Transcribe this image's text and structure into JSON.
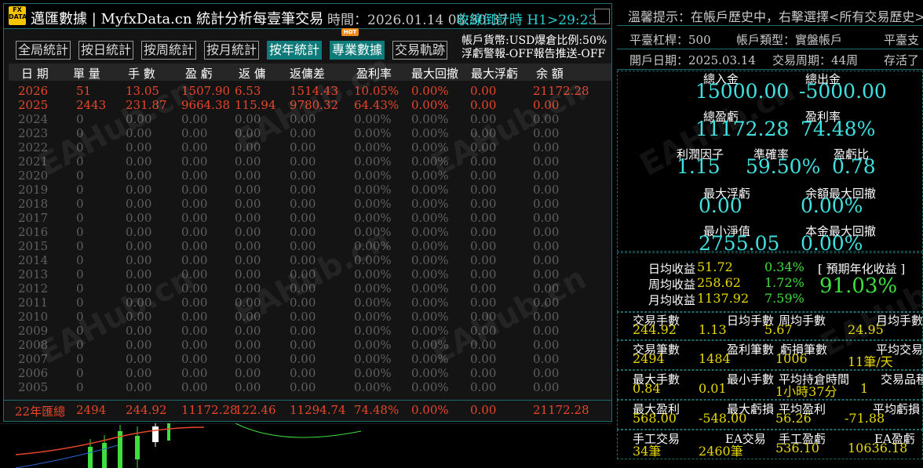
{
  "window": {
    "logo_top": "FX",
    "logo_bottom": "DATA",
    "title": "邁匯數據 | MyfxData.cn  統計分析每壹筆交易",
    "time": "時間：2026.01.14 08:30:37",
    "countdown": "收線倒計時  H1>29:23"
  },
  "tabs": [
    {
      "label": "全局統計"
    },
    {
      "label": "按日統計"
    },
    {
      "label": "按周統計"
    },
    {
      "label": "按月統計"
    },
    {
      "label": "按年統計"
    },
    {
      "label": "專業數據"
    },
    {
      "label": "交易軌跡"
    }
  ],
  "hot_badge": "HOT",
  "account_info": {
    "line1": "帳戶貨幣:USD",
    "line1b": "爆倉比例:50%",
    "line2": "浮虧警報-OFF",
    "line2b": "報告推送-OFF"
  },
  "table": {
    "headers": [
      "日 期",
      "單 量",
      "手 數",
      "盈 虧",
      "返 傭",
      "返傭差",
      "盈利率",
      "最大回撤",
      "最大浮虧",
      "余 額"
    ],
    "rows": [
      [
        "2026",
        "51",
        "13.05",
        "1507.90",
        "6.53",
        "1514.43",
        "10.05%",
        "0.00%",
        "0.00",
        "21172.28"
      ],
      [
        "2025",
        "2443",
        "231.87",
        "9664.38",
        "115.94",
        "9780.32",
        "64.43%",
        "0.00%",
        "0.00",
        "0.00"
      ],
      [
        "2024",
        "0",
        "0.00",
        "0.00",
        "0.00",
        "0.00",
        "0.00%",
        "0.00%",
        "0.00",
        "0.00"
      ],
      [
        "2023",
        "0",
        "0.00",
        "0.00",
        "0.00",
        "0.00",
        "0.00%",
        "0.00%",
        "0.00",
        "0.00"
      ],
      [
        "2022",
        "0",
        "0.00",
        "0.00",
        "0.00",
        "0.00",
        "0.00%",
        "0.00%",
        "0.00",
        "0.00"
      ],
      [
        "2021",
        "0",
        "0.00",
        "0.00",
        "0.00",
        "0.00",
        "0.00%",
        "0.00%",
        "0.00",
        "0.00"
      ],
      [
        "2020",
        "0",
        "0.00",
        "0.00",
        "0.00",
        "0.00",
        "0.00%",
        "0.00%",
        "0.00",
        "0.00"
      ],
      [
        "2019",
        "0",
        "0.00",
        "0.00",
        "0.00",
        "0.00",
        "0.00%",
        "0.00%",
        "0.00",
        "0.00"
      ],
      [
        "2018",
        "0",
        "0.00",
        "0.00",
        "0.00",
        "0.00",
        "0.00%",
        "0.00%",
        "0.00",
        "0.00"
      ],
      [
        "2017",
        "0",
        "0.00",
        "0.00",
        "0.00",
        "0.00",
        "0.00%",
        "0.00%",
        "0.00",
        "0.00"
      ],
      [
        "2016",
        "0",
        "0.00",
        "0.00",
        "0.00",
        "0.00",
        "0.00%",
        "0.00%",
        "0.00",
        "0.00"
      ],
      [
        "2015",
        "0",
        "0.00",
        "0.00",
        "0.00",
        "0.00",
        "0.00%",
        "0.00%",
        "0.00",
        "0.00"
      ],
      [
        "2014",
        "0",
        "0.00",
        "0.00",
        "0.00",
        "0.00",
        "0.00%",
        "0.00%",
        "0.00",
        "0.00"
      ],
      [
        "2013",
        "0",
        "0.00",
        "0.00",
        "0.00",
        "0.00",
        "0.00%",
        "0.00%",
        "0.00",
        "0.00"
      ],
      [
        "2012",
        "0",
        "0.00",
        "0.00",
        "0.00",
        "0.00",
        "0.00%",
        "0.00%",
        "0.00",
        "0.00"
      ],
      [
        "2011",
        "0",
        "0.00",
        "0.00",
        "0.00",
        "0.00",
        "0.00%",
        "0.00%",
        "0.00",
        "0.00"
      ],
      [
        "2010",
        "0",
        "0.00",
        "0.00",
        "0.00",
        "0.00",
        "0.00%",
        "0.00%",
        "0.00",
        "0.00"
      ],
      [
        "2009",
        "0",
        "0.00",
        "0.00",
        "0.00",
        "0.00",
        "0.00%",
        "0.00%",
        "0.00",
        "0.00"
      ],
      [
        "2008",
        "0",
        "0.00",
        "0.00",
        "0.00",
        "0.00",
        "0.00%",
        "0.00%",
        "0.00",
        "0.00"
      ],
      [
        "2007",
        "0",
        "0.00",
        "0.00",
        "0.00",
        "0.00",
        "0.00%",
        "0.00%",
        "0.00",
        "0.00"
      ],
      [
        "2006",
        "0",
        "0.00",
        "0.00",
        "0.00",
        "0.00",
        "0.00%",
        "0.00%",
        "0.00",
        "0.00"
      ],
      [
        "2005",
        "0",
        "0.00",
        "0.00",
        "0.00",
        "0.00",
        "0.00%",
        "0.00%",
        "0.00",
        "0.00"
      ]
    ],
    "summary": [
      "22年匯總",
      "2494",
      "244.92",
      "11172.28",
      "122.46",
      "11294.74",
      "74.48%",
      "0.00%",
      "0.00",
      "21172.28"
    ]
  },
  "right": {
    "tip": "溫馨提示：在帳戶歷史中，右擊選擇<所有交易歷史>",
    "leverage": "平臺杠桿：500",
    "acct_type": "帳戶類型：實盤帳戶",
    "platform": "平臺支",
    "open_date": "開戶日期：2025.03.14",
    "cycle": "交易周期：44周",
    "survive": "存活了",
    "deposit_label": "總入金",
    "deposit": "15000.00",
    "withdraw_label": "總出金",
    "withdraw": "-5000.00",
    "pnl_label": "總盈虧",
    "pnl": "11172.28",
    "rate_label": "盈利率",
    "rate": "74.48%",
    "pf_label": "利潤因子",
    "pf": "1.15",
    "acc_label": "準確率",
    "acc": "59.50%",
    "ratio_label": "盈虧比",
    "ratio": "0.78",
    "maxfl_label": "最大浮虧",
    "maxfl": "0.00",
    "baldd_label": "余額最大回撤",
    "baldd": "0.00%",
    "mineq_label": "最小淨值",
    "mineq": "2755.05",
    "capdd_label": "本金最大回撤",
    "capdd": "0.00%",
    "daily_label": "日均收益",
    "daily": "51.72",
    "daily_pct": "0.34%",
    "weekly_label": "周均收益",
    "weekly": "258.62",
    "weekly_pct": "1.72%",
    "monthly_label": "月均收益",
    "monthly": "1137.92",
    "monthly_pct": "7.59%",
    "annual_label": "[ 預期年化收益 ]",
    "annual": "91.03%",
    "lots_label": "交易手數",
    "lots": "244.92",
    "daylots_label": "日均手數",
    "daylots": "1.13",
    "weeklots_label": "周均手數",
    "weeklots": "5.67",
    "monthlots_label": "月均手數",
    "monthlots": "24.95",
    "trades_label": "交易筆數",
    "trades": "2494",
    "wins_label": "盈利筆數",
    "wins": "1484",
    "losses_label": "虧損筆數",
    "losses": "1006",
    "avgtrades_label": "平均交易",
    "avgtrades": "11筆/天",
    "maxlot_label": "最大手數",
    "maxlot": "0.84",
    "minlot_label": "最小手數",
    "minlot": "0.01",
    "hold_label": "平均持倉時間",
    "hold": "1小時37分",
    "products_label": "交易品種",
    "products": "1",
    "maxwin_label": "最大盈利",
    "maxwin": "568.00",
    "maxloss_label": "最大虧損",
    "maxloss": "-548.00",
    "avgwin_label": "平均盈利",
    "avgwin": "56.26",
    "avgloss_label": "平均虧損",
    "avgloss": "-71.88",
    "manual_label": "手工交易",
    "manual": "34筆",
    "ea_label": "EA交易",
    "ea": "2460筆",
    "manualpnl_label": "手工盈虧",
    "manualpnl": "536.10",
    "eapnl_label": "EA盈虧",
    "eapnl": "10636.18"
  },
  "colors": {
    "accent": "#0e7a7a",
    "positive": "#e8452a",
    "cyan": "#3ee0e0",
    "yellow": "#e6d800",
    "green": "#3ede3e"
  }
}
